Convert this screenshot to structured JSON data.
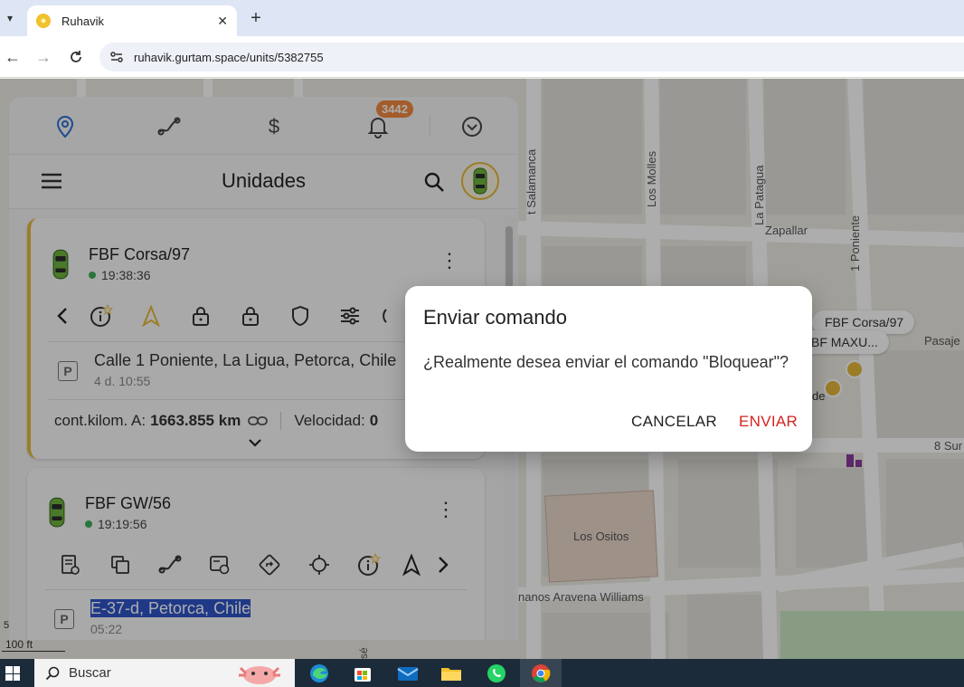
{
  "browser": {
    "tab_title": "Ruhavik",
    "url": "ruhavik.gurtam.space/units/5382755"
  },
  "map": {
    "streets": [
      "t Salamanca",
      "Los Molles",
      "La Patagua",
      "Zapallar",
      "1 Poniente",
      "Pasaje",
      "8 Sur",
      "Los Ositos",
      "nanos Aravena Williams",
      "sé"
    ],
    "markers": [
      "FBF Corsa/97",
      "BF MAXU..."
    ],
    "marker_partial": "de",
    "scale": "100 ft",
    "scale_top": "5"
  },
  "panel": {
    "notifications_count": "3442",
    "title": "Unidades"
  },
  "units": [
    {
      "name": "FBF Corsa/97",
      "time": "19:38:36",
      "address": "Calle 1 Poniente, La Ligua, Petorca, Chile",
      "address_sub": "4 d. 10:55",
      "odometer_label": "cont.kilom. A:",
      "odometer_value": "1663.855 km",
      "speed_label": "Velocidad:",
      "speed_value": "0"
    },
    {
      "name": "FBF GW/56",
      "time": "19:19:56",
      "address": "E-37-d, Petorca, Chile",
      "address_sub": "05:22"
    }
  ],
  "dialog": {
    "title": "Enviar comando",
    "message": "¿Realmente desea enviar el comando \"Bloquear\"?",
    "cancel": "CANCELAR",
    "send": "ENVIAR"
  },
  "taskbar": {
    "search_text": "Buscar"
  },
  "colors": {
    "accent_blue": "#2f6fd6",
    "selected_border": "#e5b83c",
    "send_red": "#d42424",
    "badge": "#f0883e",
    "online": "#3dae5c"
  }
}
